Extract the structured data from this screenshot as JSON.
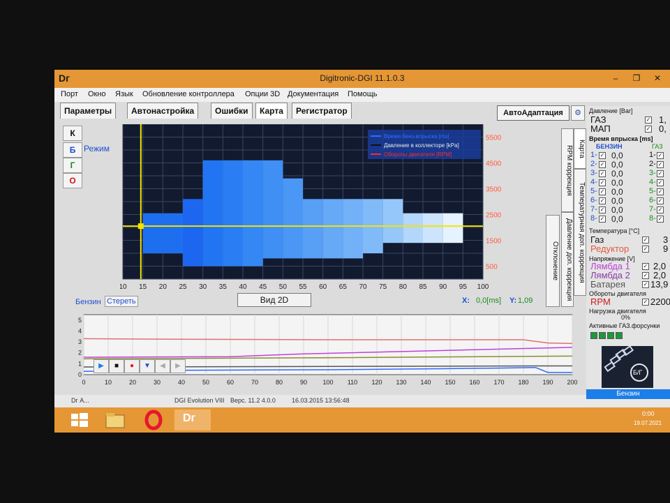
{
  "window": {
    "logo": "Dг",
    "title": "Digitronic-DGI  11.1.0.3",
    "minimize": "–",
    "restore": "❐",
    "close": "✕"
  },
  "menu": [
    "Порт",
    "Окно",
    "Язык",
    "Обновление контроллера",
    "Опции 3D",
    "Документация",
    "Помощь"
  ],
  "tabs": [
    "Параметры",
    "Автонастройка",
    "Ошибки",
    "Карта",
    "Регистратор"
  ],
  "auto_adapt": "АвтоАдаптация",
  "side_buttons": [
    {
      "label": "К",
      "color": "#111111"
    },
    {
      "label": "Б",
      "color": "#1f4fd0"
    },
    {
      "label": "Г",
      "color": "#1a8a1a"
    },
    {
      "label": "О",
      "color": "#d01818"
    }
  ],
  "mode_label": "Режим",
  "vertical_tabs": [
    "RPM коррекция",
    "Карта",
    "Температурная доп. коррекция",
    "Давление доп. коррекция",
    "Отклонение"
  ],
  "legend": [
    {
      "label": "Время бенз.впрыска [ms]",
      "color": "#2d6cff"
    },
    {
      "label": "Давление в коллекторе [kPa]",
      "color": "#111111"
    },
    {
      "label": "Обороты двигателя [RPM]",
      "color": "#ff2a2a"
    }
  ],
  "map": {
    "x_ticks": [
      "10",
      "15",
      "20",
      "25",
      "30",
      "35",
      "40",
      "45",
      "50",
      "55",
      "60",
      "65",
      "70",
      "75",
      "80",
      "85",
      "90",
      "95",
      "100"
    ],
    "y_ticks": [
      "500",
      "1500",
      "2500",
      "3500",
      "4500",
      "5500"
    ],
    "cursor_x": 14.5,
    "cursor_rpm": 2050,
    "columns": [
      {
        "x": 15,
        "bottom": 1000,
        "top": 2550,
        "color": "#1e6ff0"
      },
      {
        "x": 20,
        "bottom": 1000,
        "top": 2550,
        "color": "#1e6ff0"
      },
      {
        "x": 25,
        "bottom": 500,
        "top": 3100,
        "color": "#1c66f0"
      },
      {
        "x": 30,
        "bottom": 500,
        "top": 4600,
        "color": "#2275f2"
      },
      {
        "x": 35,
        "bottom": 500,
        "top": 4600,
        "color": "#2a7df3"
      },
      {
        "x": 40,
        "bottom": 500,
        "top": 4600,
        "color": "#3588f4"
      },
      {
        "x": 45,
        "bottom": 800,
        "top": 4600,
        "color": "#3f8ff4"
      },
      {
        "x": 50,
        "bottom": 800,
        "top": 3900,
        "color": "#4b97f5"
      },
      {
        "x": 55,
        "bottom": 800,
        "top": 3100,
        "color": "#58a0f6"
      },
      {
        "x": 60,
        "bottom": 800,
        "top": 3100,
        "color": "#66a9f7"
      },
      {
        "x": 65,
        "bottom": 800,
        "top": 3100,
        "color": "#72b1f8"
      },
      {
        "x": 70,
        "bottom": 1000,
        "top": 3100,
        "color": "#80baf9"
      },
      {
        "x": 75,
        "bottom": 1400,
        "top": 3100,
        "color": "#95c7fa"
      },
      {
        "x": 80,
        "bottom": 1400,
        "top": 2550,
        "color": "#b3d6fb"
      },
      {
        "x": 85,
        "bottom": 1400,
        "top": 2550,
        "color": "#cce4fc"
      },
      {
        "x": 90,
        "bottom": 1400,
        "top": 2550,
        "color": "#e6f2fe"
      }
    ]
  },
  "under_map": {
    "benzin": "Бензин",
    "clear": "Стереть",
    "view2d": "Вид 2D",
    "x_label": "X:",
    "x_value": "0,0[ms]",
    "y_label": "Y:",
    "y_value": "1,09"
  },
  "plot": {
    "y_ticks": [
      "0",
      "1",
      "2",
      "3",
      "4",
      "5"
    ],
    "x_ticks": [
      "0",
      "10",
      "20",
      "30",
      "40",
      "50",
      "60",
      "70",
      "80",
      "90",
      "100",
      "110",
      "120",
      "130",
      "140",
      "150",
      "160",
      "170",
      "180",
      "190",
      "200"
    ],
    "series": [
      {
        "name": "red",
        "color": "#e07070",
        "points": [
          [
            0,
            3.3
          ],
          [
            30,
            3.25
          ],
          [
            100,
            3.2
          ],
          [
            180,
            3.2
          ],
          [
            190,
            2.9
          ],
          [
            200,
            2.85
          ]
        ]
      },
      {
        "name": "magenta",
        "color": "#c040d8",
        "points": [
          [
            0,
            1.6
          ],
          [
            60,
            1.65
          ],
          [
            90,
            1.9
          ],
          [
            190,
            2.45
          ],
          [
            200,
            2.5
          ]
        ]
      },
      {
        "name": "olive",
        "color": "#8c8c30",
        "points": [
          [
            0,
            1.45
          ],
          [
            100,
            1.55
          ],
          [
            200,
            1.7
          ]
        ]
      },
      {
        "name": "blue",
        "color": "#2d6cff",
        "points": [
          [
            0,
            0.3
          ],
          [
            40,
            0.4
          ],
          [
            100,
            0.45
          ],
          [
            150,
            0.55
          ],
          [
            170,
            0.6
          ],
          [
            185,
            0.65
          ],
          [
            190,
            0.2
          ],
          [
            200,
            0.2
          ]
        ]
      },
      {
        "name": "gray",
        "color": "#555555",
        "points": [
          [
            0,
            0.7
          ],
          [
            100,
            0.75
          ],
          [
            190,
            0.8
          ],
          [
            200,
            0.8
          ]
        ]
      }
    ]
  },
  "status": {
    "left": "Dг  A...",
    "program": "DGI Evolution VIII",
    "version": "Верс. 11.2  4.0.0",
    "timestamp": "16.03.2015 13:56:48"
  },
  "tray": {
    "time": "0:00",
    "date": "19.07.2021"
  },
  "right_panel": {
    "pressure_header": "Давление [Bar]",
    "gaz_label": "ГАЗ",
    "gaz_value": "1,",
    "map_label": "МАП",
    "map_value": "0,",
    "inj_header": "Время впрыска [ms]",
    "col_benzin": "БЕНЗИН",
    "col_gaz": "ГАЗ",
    "inj_rows": [
      {
        "n": "1",
        "v": "0,0",
        "g": "1"
      },
      {
        "n": "2",
        "v": "0,0",
        "g": "2"
      },
      {
        "n": "3",
        "v": "0,0",
        "g": "3"
      },
      {
        "n": "4",
        "v": "0,0",
        "g": "4"
      },
      {
        "n": "5",
        "v": "0,0",
        "g": "5"
      },
      {
        "n": "6",
        "v": "0,0",
        "g": "6"
      },
      {
        "n": "7",
        "v": "0,0",
        "g": "7"
      },
      {
        "n": "8",
        "v": "0,0",
        "g": "8"
      }
    ],
    "temp_header": "Температура [°C]",
    "temp_gaz": "Газ",
    "temp_gaz_val": "3",
    "temp_red": "Редуктор",
    "temp_red_val": "9",
    "volt_header": "Напряжение [V]",
    "lambda1": "Лямбда 1",
    "lambda1_val": "2,0",
    "lambda2": "Лямбда 2",
    "lambda2_val": "2,0",
    "battery": "Батарея",
    "battery_val": "13,9",
    "rpm_header": "Обороты двигателя",
    "rpm_label": "RPM",
    "rpm_value": "2200",
    "load_header": "Нагрузка двигателя",
    "load_value": "0%",
    "active_header": "Активные ГАЗ.форсунки",
    "bg_label": "Б/Г",
    "fuel_bar": "Бензин"
  }
}
